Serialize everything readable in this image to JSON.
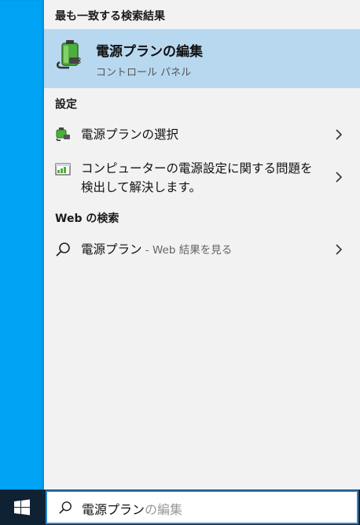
{
  "panel": {
    "best_match_header": "最も一致する検索結果",
    "best_match": {
      "title": "電源プランの編集",
      "subtitle": "コントロール パネル",
      "icon": "power-plan-battery-icon"
    },
    "settings_header": "設定",
    "settings_items": [
      {
        "label": "電源プランの選択",
        "icon": "power-options-icon"
      },
      {
        "label_line1": "コンピューターの電源設定に関する問題を",
        "label_line2": "検出して解決します。",
        "icon": "troubleshoot-power-icon"
      }
    ],
    "web_header": "Web の検索",
    "web_item": {
      "query": "電源プラン",
      "suffix": " - Web 結果を見る",
      "icon": "search-icon"
    }
  },
  "taskbar": {
    "search_typed": "電源プラン",
    "search_completion": "の編集"
  },
  "colors": {
    "sidebar": "#00a2f4",
    "selected": "#b8d8f0",
    "taskbar": "#0f2234",
    "search_border": "#2b8bd6"
  }
}
